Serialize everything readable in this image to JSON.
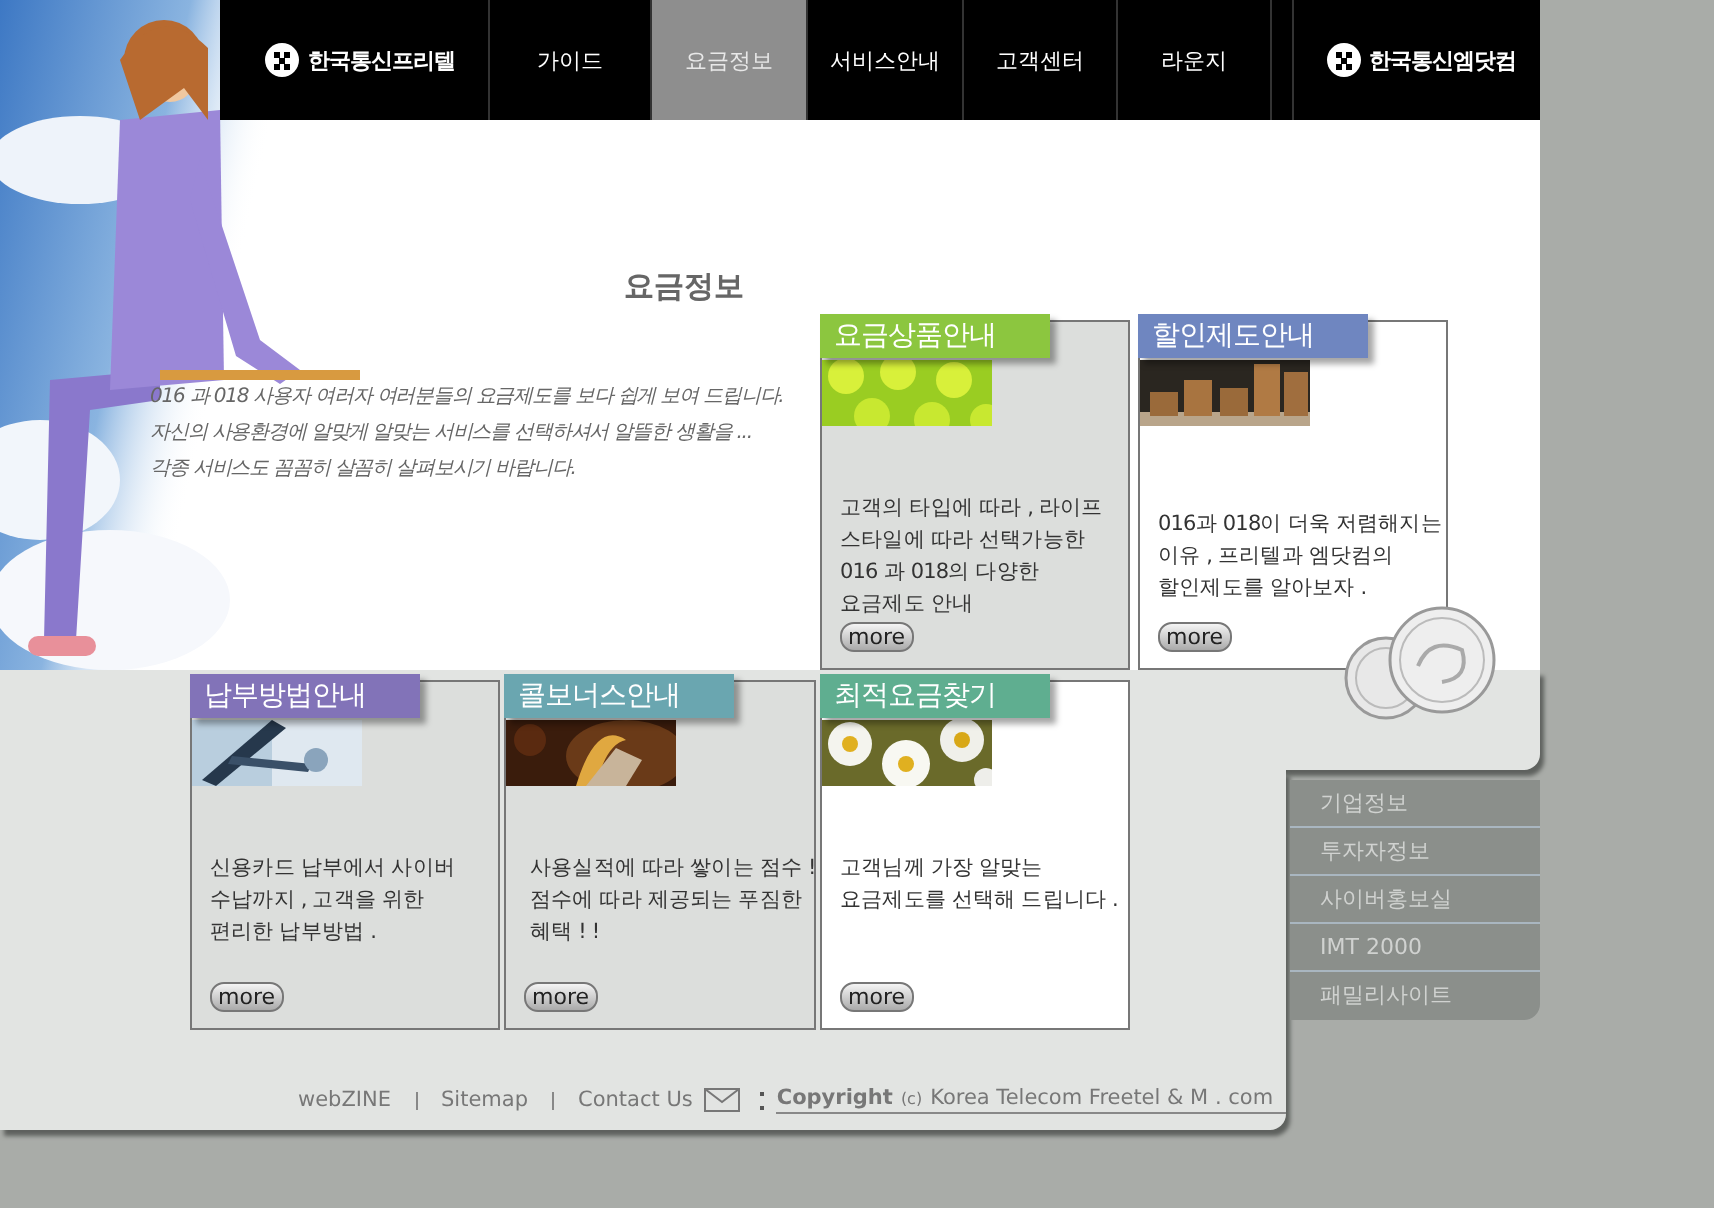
{
  "nav": {
    "logos": [
      {
        "label": "한국통신프리텔"
      },
      {
        "label": "한국통신엠닷컴"
      }
    ],
    "tabs": [
      {
        "label": "가이드",
        "selected": false
      },
      {
        "label": "요금정보",
        "selected": true
      },
      {
        "label": "서비스안내",
        "selected": false
      },
      {
        "label": "고객센터",
        "selected": false
      },
      {
        "label": "라운지",
        "selected": false
      }
    ]
  },
  "intro": {
    "title": "요금정보",
    "lines": [
      "016 과 018 사용자 여러자 여러분들의 요금제도를 보다 쉽게 보여 드립니다.",
      "자신의 사용환경에 알맞게 알맞는 서비스를 선택하셔서 알뜰한 생활을 ...",
      "각종 서비스도 꼼꼼히 살꼼히 살펴보시기 바랍니다."
    ]
  },
  "cards": [
    {
      "title": "요금상품안내",
      "color": "#8cc63f",
      "kind": "shaded",
      "lines": [
        "고객의 타입에 따라 , 라이프",
        "스타일에 따라 선택가능한",
        "016 과 018의 다양한",
        "요금제도 안내"
      ],
      "button": "more"
    },
    {
      "title": "할인제도안내",
      "color": "#6f86c0",
      "kind": "plain",
      "lines": [
        "016과 018이 더욱 저렴해지는",
        "이유 , 프리텔과 엠닷컴의",
        "할인제도를 알아보자 ."
      ],
      "button": "more"
    },
    {
      "title": "납부방법안내",
      "color": "#8273b8",
      "kind": "shaded",
      "lines": [
        "신용카드 납부에서 사이버",
        "수납까지 , 고객을 위한",
        "편리한 납부방법 ."
      ],
      "button": "more"
    },
    {
      "title": "콜보너스안내",
      "color": "#6aa6b0",
      "kind": "shaded",
      "lines": [
        "사용실적에 따라 쌓이는 점수 !",
        "점수에 따라 제공되는 푸짐한",
        "혜택 ! !"
      ],
      "button": "more"
    },
    {
      "title": "최적요금찾기",
      "color": "#5fae90",
      "kind": "plain",
      "lines": [
        "고객님께 가장 알맞는",
        "요금제도를 선택해 드립니다 ."
      ],
      "button": "more"
    }
  ],
  "side_menu": {
    "items": [
      "기업정보",
      "투자자정보",
      "사이버홍보실",
      "IMT 2000",
      "패밀리사이트"
    ]
  },
  "footer": {
    "links": [
      "webZINE",
      "Sitemap",
      "Contact Us"
    ],
    "copyright_label": "Copyright",
    "copyright_mark": "(c)",
    "copyright_owner": "Korea Telecom Freetel & M . com"
  }
}
